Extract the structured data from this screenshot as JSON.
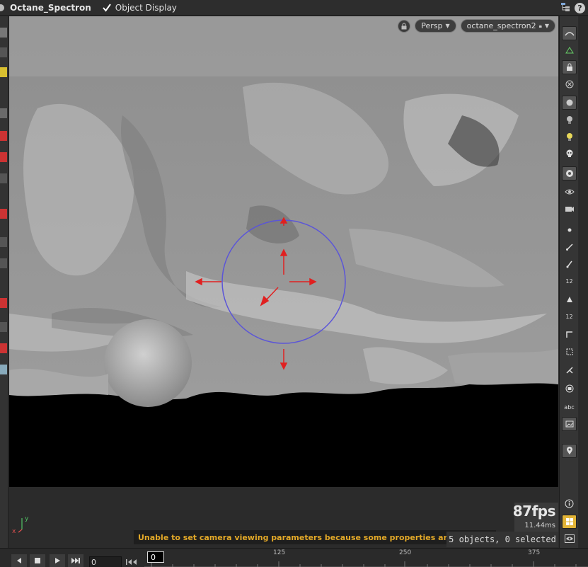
{
  "header": {
    "node_name": "Octane_Spectron",
    "object_display_label": "Object Display",
    "help_label": "?"
  },
  "viewport": {
    "camera_mode": "Persp",
    "camera_name": "octane_spectron2",
    "render_color": "#9a9a9a",
    "handle_color": "#e02020",
    "gizmo_ring_color": "#5b55d8"
  },
  "right_toolbar": {
    "label_12a": "12",
    "label_12b": "12",
    "label_abc": "abc"
  },
  "bottom": {
    "axis_y": "y",
    "axis_x": "x",
    "status_message": "Unable to set camera viewing parameters because some properties are missing.",
    "status_color": "#e3a928",
    "fps": "87fps",
    "frame_time": "11.44ms",
    "selection_info": "5 objects, 0 selected"
  },
  "timeline": {
    "frame_value": "0",
    "current_frame": "0",
    "ticks": [
      "125",
      "250",
      "375"
    ]
  }
}
